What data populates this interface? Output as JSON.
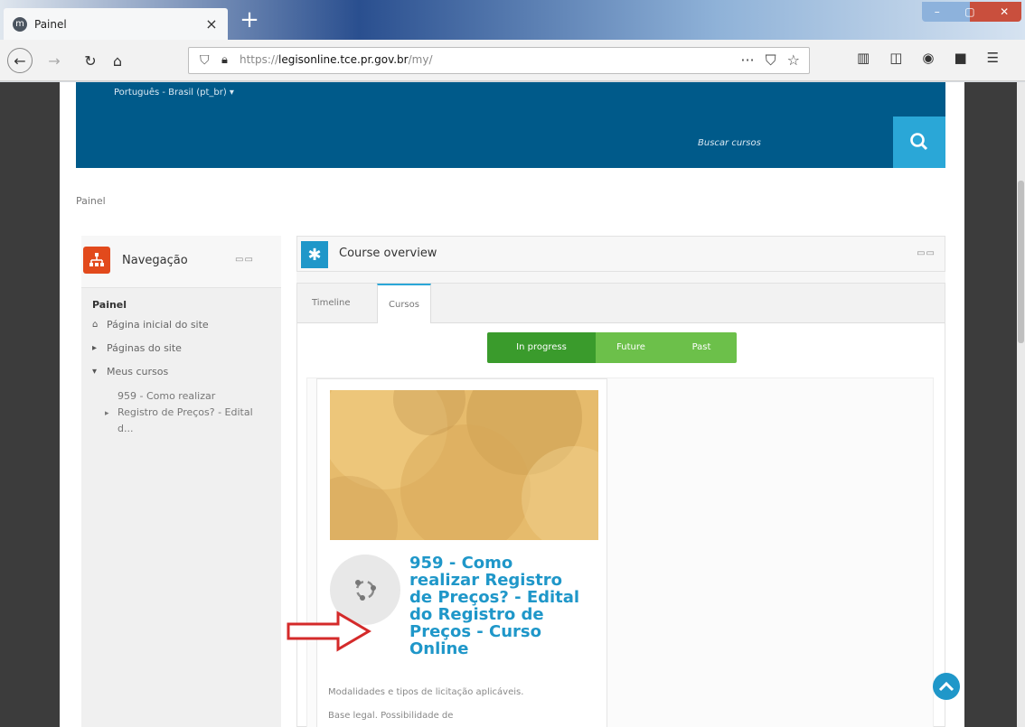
{
  "browser": {
    "tab_title": "Painel",
    "tab_close": "×",
    "new_tab": "+",
    "url_prefix": "https://",
    "url_host": "legisonline.tce.pr.gov.br",
    "url_path": "/my/",
    "url_more": "···"
  },
  "site": {
    "language_menu": "Português - Brasil (pt_br) ▾",
    "search_link": "Buscar cursos"
  },
  "breadcrumb": "Painel",
  "navigation": {
    "title": "Navegação",
    "items": [
      {
        "label": "Painel"
      },
      {
        "label": "Página inicial do site",
        "icon": "home-icon"
      },
      {
        "label": "Páginas do site",
        "icon": "caret-right-icon"
      },
      {
        "label": "Meus cursos",
        "icon": "caret-down-icon"
      },
      {
        "label": "959 - Como realizar Registro de Preços? - Edital d..."
      }
    ]
  },
  "course_overview": {
    "title": "Course overview",
    "tabs": [
      {
        "label": "Timeline"
      },
      {
        "label": "Cursos"
      }
    ],
    "filters": [
      {
        "label": "In progress"
      },
      {
        "label": "Future"
      },
      {
        "label": "Past"
      }
    ],
    "course": {
      "title": "959 - Como realizar Registro de Preços? - Edital do Registro de Preços - Curso Online",
      "summary_line_1": "Modalidades e tipos de licitação aplicáveis.",
      "summary_line_2": "Base legal. Possibilidade de"
    }
  },
  "colors": {
    "header_blue": "#005a8a",
    "search_button": "#2aa7d7",
    "course_title": "#1f97c9",
    "filter_active": "#3a9b2c",
    "filter_inactive": "#6cc04a",
    "nav_icon": "#e24a1c",
    "arrow": "#d42a2a"
  }
}
